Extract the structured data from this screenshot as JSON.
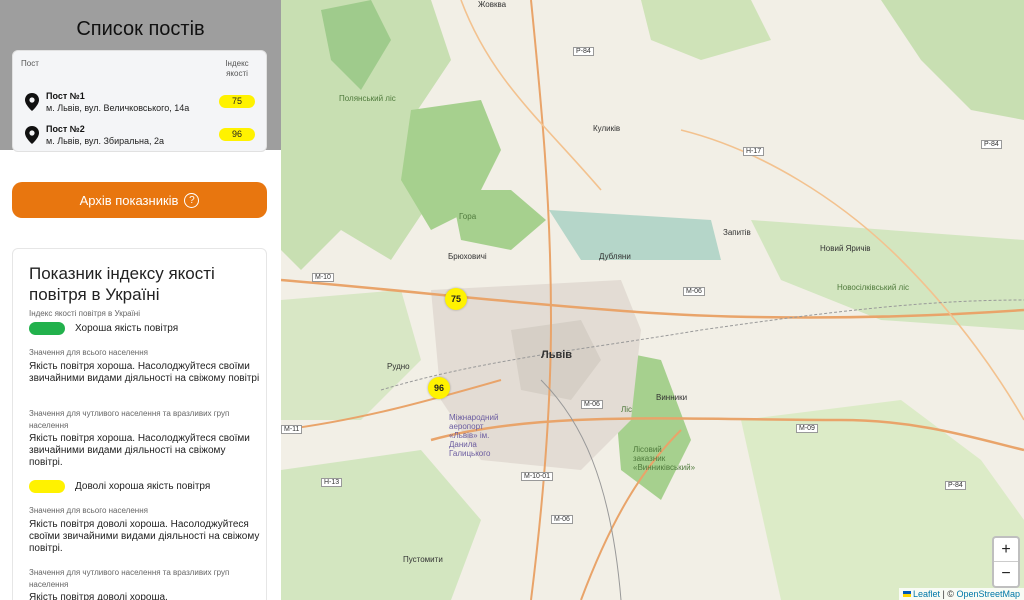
{
  "sidebar": {
    "title": "Список постів",
    "table": {
      "col_post": "Пост",
      "col_index": "Індекс якості",
      "posts": [
        {
          "name": "Пост №1",
          "address": "м. Львів, вул. Величковського, 14а",
          "index": "75"
        },
        {
          "name": "Пост №2",
          "address": "м. Львів, вул. Збиральна, 2а",
          "index": "96"
        }
      ]
    },
    "archive_button": {
      "label": "Архів показників",
      "help": "?"
    }
  },
  "aqi": {
    "title": "Показник індексу якості повітря в Україні",
    "legend_label": "Індекс якості повітря в Україні",
    "levels": [
      {
        "color": "#22b14c",
        "label": "Хороша якість повітря",
        "general_label": "Значення для всього населення",
        "general_text": "Якість повітря хороша. Насолоджуйтеся своїми звичайними видами діяльності на свіжому повітрі",
        "sensitive_label": "Значення для чутливого населення та вразливих груп населення",
        "sensitive_text": "Якість повітря хороша. Насолоджуйтеся своїми звичайними видами діяльності на свіжому повітрі."
      },
      {
        "color": "#fff200",
        "label": "Доволі хороша якість повітря",
        "general_label": "Значення для всього населення",
        "general_text": "Якість повітря доволі хороша. Насолоджуйтеся своїми звичайними видами діяльності на свіжому повітрі.",
        "sensitive_label": "Значення для чутливого населення та вразливих груп населення",
        "sensitive_text": "Якість повітря доволі хороша."
      }
    ]
  },
  "map": {
    "markers": [
      {
        "value": "75",
        "color": "#fff200"
      },
      {
        "value": "96",
        "color": "#fff200"
      }
    ],
    "places": {
      "lviv": "Львів",
      "zhovkva": "Жовква",
      "kulykiv": "Куликів",
      "briukhovychi": "Брюховичі",
      "dublyany": "Дубляни",
      "zapytiv": "Запитів",
      "novyi_yarychiv": "Новий Яричів",
      "rudno": "Рудно",
      "vynnyky": "Винники",
      "pustomyty": "Пустомити",
      "polianskyi": "Полянський ліс",
      "lys_hora": "Гора",
      "novosilky": "Новосілківський ліс",
      "airport": "Міжнародний аеропорт «Львів» ім. Данила Галицького",
      "lisovyi": "Лісовий заказник «Винниківський»",
      "vynnyky_lis": "Ліс"
    },
    "roads": [
      "Р-84",
      "Н-17",
      "Р-84",
      "М-10",
      "М-06",
      "М-06",
      "М-11",
      "М-09",
      "Н-13",
      "М-10-01",
      "М-06",
      "Р-84"
    ],
    "zoom_in": "+",
    "zoom_out": "−",
    "attribution": {
      "leaflet": "Leaflet",
      "sep": " | © ",
      "osm": "OpenStreetMap"
    }
  }
}
